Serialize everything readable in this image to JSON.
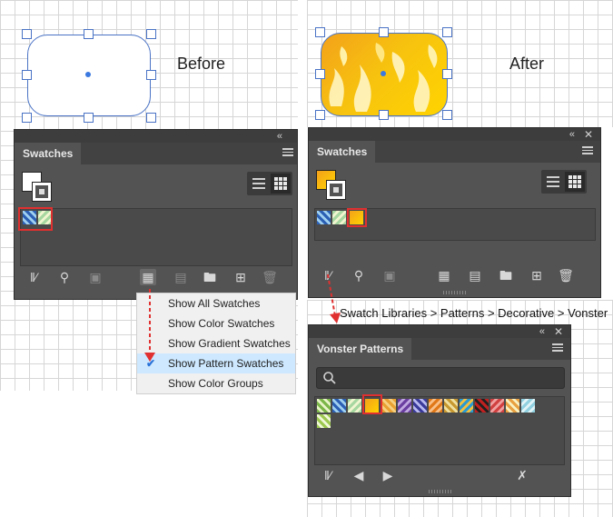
{
  "before_label": "Before",
  "after_label": "After",
  "left_panel": {
    "tab": "Swatches",
    "menu_items": [
      {
        "label": "Show All Swatches",
        "checked": false
      },
      {
        "label": "Show Color Swatches",
        "checked": false
      },
      {
        "label": "Show Gradient Swatches",
        "checked": false
      },
      {
        "label": "Show Pattern Swatches",
        "checked": true
      },
      {
        "label": "Show Color Groups",
        "checked": false
      }
    ]
  },
  "right_panel": {
    "tab": "Swatches"
  },
  "path_caption": "Swatch Libraries > Patterns > Decorative > Vonster",
  "library_panel": {
    "tab": "Vonster Patterns"
  },
  "colors": {
    "accent_red": "#e03030",
    "selection_blue": "#4a73c5",
    "panel_bg": "#535353"
  }
}
